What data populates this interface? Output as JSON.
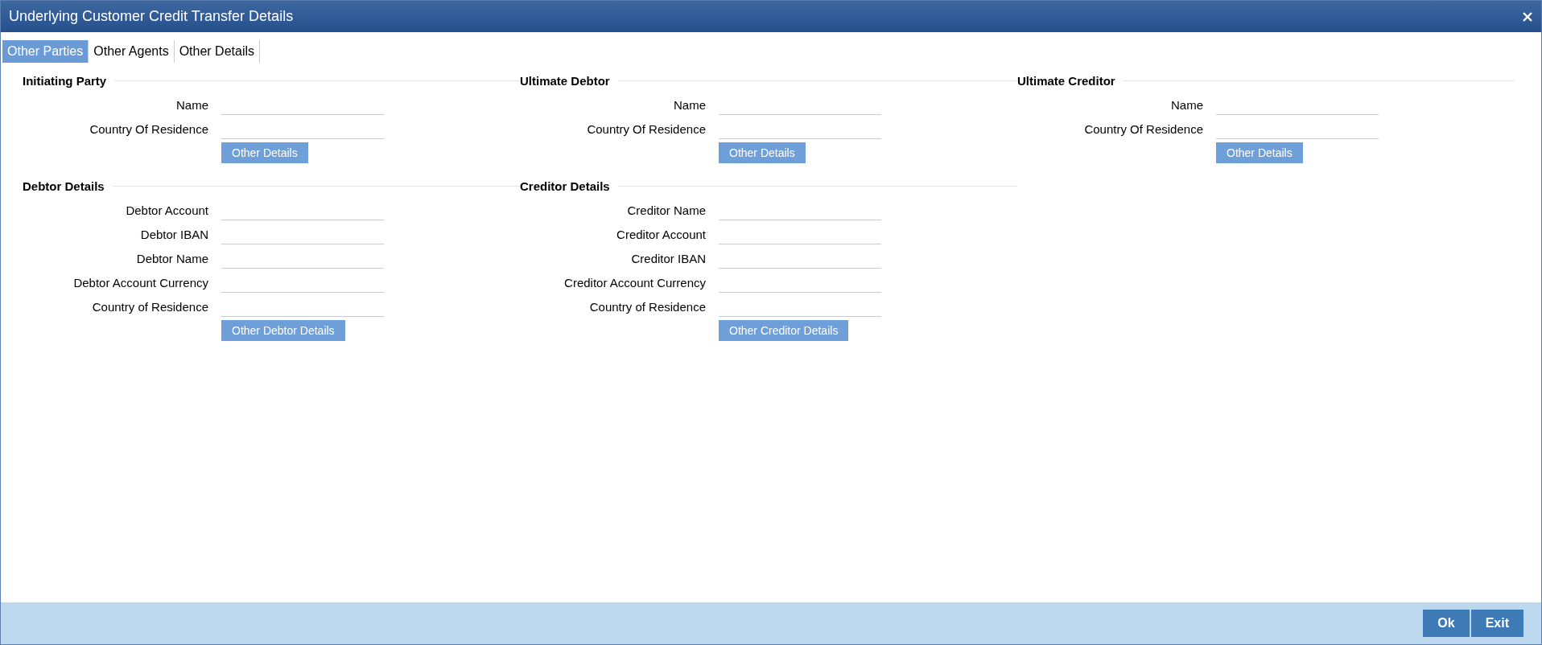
{
  "window": {
    "title": "Underlying Customer Credit Transfer Details"
  },
  "tabs": [
    {
      "label": "Other Parties",
      "selected": true
    },
    {
      "label": "Other Agents",
      "selected": false
    },
    {
      "label": "Other Details",
      "selected": false
    }
  ],
  "sections": [
    {
      "title": "Initiating Party",
      "fields": [
        {
          "label": "Name"
        },
        {
          "label": "Country Of Residence"
        }
      ],
      "button": "Other Details"
    },
    {
      "title": "Ultimate Debtor",
      "fields": [
        {
          "label": "Name"
        },
        {
          "label": "Country Of Residence"
        }
      ],
      "button": "Other Details"
    },
    {
      "title": "Ultimate Creditor",
      "fields": [
        {
          "label": "Name"
        },
        {
          "label": "Country Of Residence"
        }
      ],
      "button": "Other Details"
    },
    {
      "title": "Debtor Details",
      "fields": [
        {
          "label": "Debtor Account"
        },
        {
          "label": "Debtor IBAN"
        },
        {
          "label": "Debtor Name"
        },
        {
          "label": "Debtor Account Currency"
        },
        {
          "label": "Country of Residence"
        }
      ],
      "button": "Other Debtor Details"
    },
    {
      "title": "Creditor Details",
      "fields": [
        {
          "label": "Creditor Name"
        },
        {
          "label": "Creditor Account"
        },
        {
          "label": "Creditor IBAN"
        },
        {
          "label": "Creditor Account Currency"
        },
        {
          "label": "Country of Residence"
        }
      ],
      "button": "Other Creditor Details"
    }
  ],
  "footer_buttons": [
    "Ok",
    "Exit"
  ]
}
